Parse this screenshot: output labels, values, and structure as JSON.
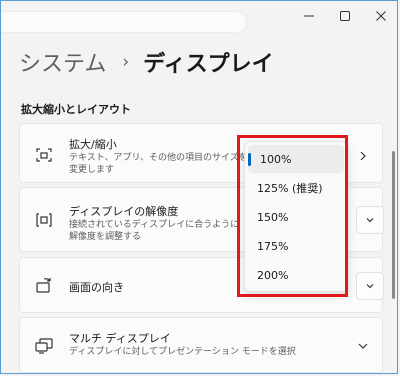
{
  "window": {
    "min_icon": "minimize-icon",
    "max_icon": "maximize-icon",
    "close_icon": "close-icon"
  },
  "breadcrumb": {
    "parent": "システム",
    "separator": "›",
    "current": "ディスプレイ"
  },
  "section": {
    "title": "拡大縮小とレイアウト"
  },
  "settings": {
    "scale": {
      "icon": "scale-icon",
      "title": "拡大/縮小",
      "desc_line1": "テキスト、アプリ、その他の項目のサイズを",
      "desc_line2": "変更します"
    },
    "resolution": {
      "icon": "resolution-icon",
      "title": "ディスプレイの解像度",
      "desc_line1": "接続されているディスプレイに合うように",
      "desc_line2": "解像度を調整する"
    },
    "orientation": {
      "icon": "orientation-icon",
      "title": "画面の向き"
    },
    "multi_display": {
      "icon": "multi-display-icon",
      "title": "マルチ ディスプレイ",
      "desc": "ディスプレイに対してプレゼンテーション モードを選択"
    }
  },
  "scale_dropdown": {
    "options": [
      "100%",
      "125% (推奨)",
      "150%",
      "175%",
      "200%"
    ],
    "selected": "100%"
  },
  "colors": {
    "accent": "#0067c0",
    "highlight": "#e0191c",
    "background": "#f3f3f3",
    "card": "#fbfbfb"
  }
}
